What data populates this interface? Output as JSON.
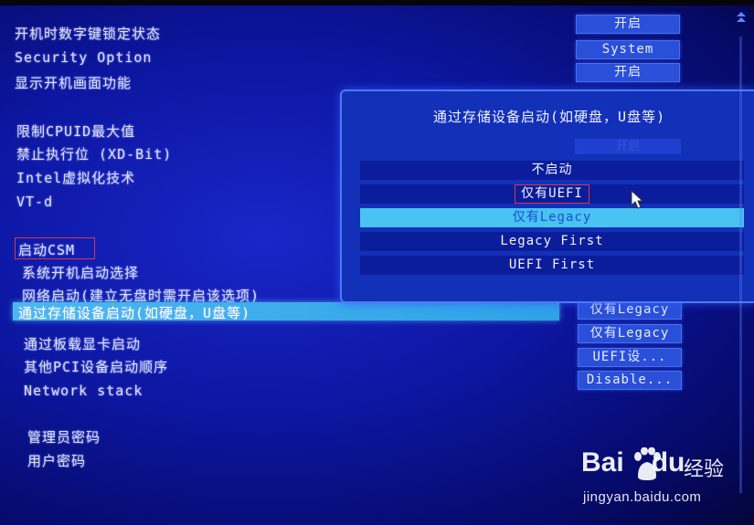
{
  "colors": {
    "background": "#0c16a0",
    "highlight": "#48c3f2",
    "value_box": "#2a4fd8",
    "marker": "#d23a4a"
  },
  "settings": [
    {
      "label": "开机时数字键锁定状态"
    },
    {
      "label": "Security Option"
    },
    {
      "label": "显示开机画面功能"
    },
    {
      "label": "限制CPUID最大值"
    },
    {
      "label": "禁止执行位 (XD-Bit)"
    },
    {
      "label": "Intel虚拟化技术"
    },
    {
      "label": "VT-d"
    },
    {
      "label": "启动CSM"
    },
    {
      "label": "系统开机启动选择"
    },
    {
      "label": "网络启动(建立无盘时需开启该选项)"
    },
    {
      "label": "通过存储设备启动(如硬盘，U盘等)"
    },
    {
      "label": "通过板载显卡启动"
    },
    {
      "label": "其他PCI设备启动顺序"
    },
    {
      "label": "Network stack"
    },
    {
      "label": "管理员密码"
    },
    {
      "label": "用户密码"
    }
  ],
  "values": {
    "numlock": "开启",
    "security": "System",
    "boot_logo": "开启",
    "storage_boot": "仅有Legacy",
    "gpu_boot": "仅有Legacy",
    "pci_boot": "UEFI设...",
    "network_stack": "Disable..."
  },
  "popup": {
    "title": "通过存储设备启动(如硬盘，U盘等)",
    "ghost_text": "开启",
    "options": [
      {
        "label": "不启动"
      },
      {
        "label": "仅有UEFI"
      },
      {
        "label": "仅有Legacy"
      },
      {
        "label": "Legacy First"
      },
      {
        "label": "UEFI First"
      }
    ],
    "selected_index": 2
  },
  "icons": {
    "scroll_up": "scroll-up-arrow-icon",
    "cursor": "mouse-cursor-icon",
    "paw": "baidu-paw-icon"
  },
  "watermark": {
    "brand_left": "Bai",
    "brand_right": "du",
    "jingyan": "经验",
    "url": "jingyan.baidu.com"
  }
}
